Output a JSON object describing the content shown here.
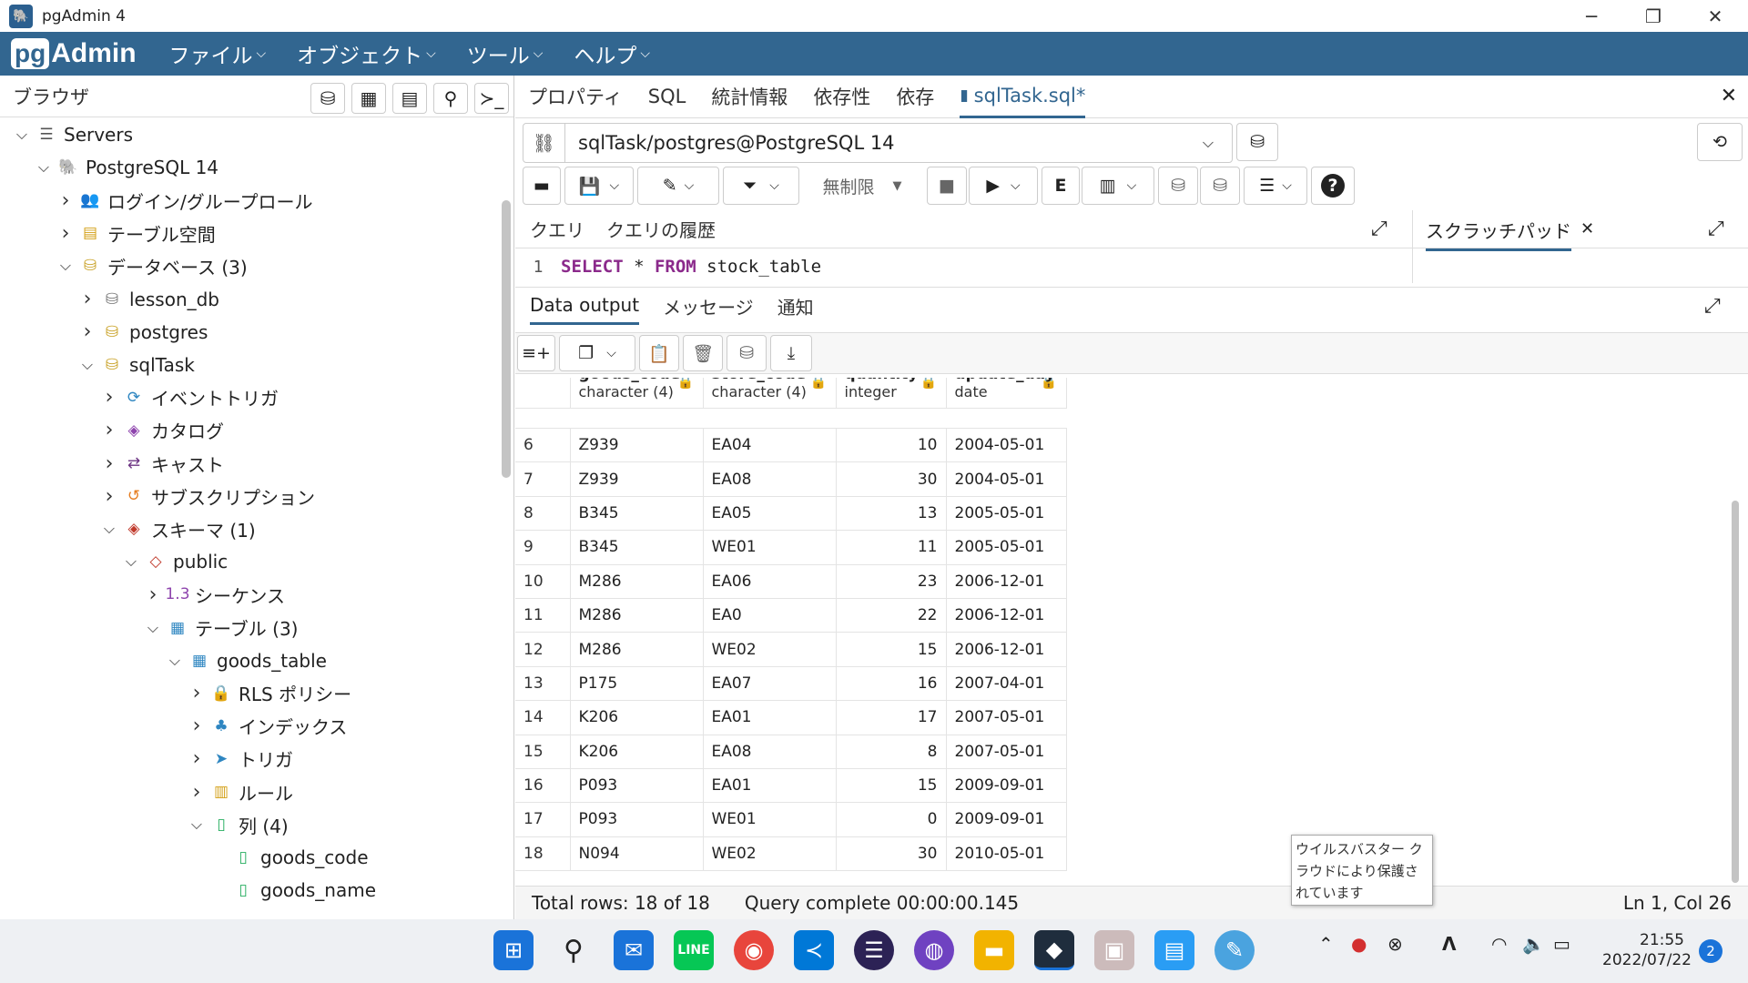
{
  "app": {
    "title": "pgAdmin 4",
    "logo_pg": "pg",
    "logo_admin": "Admin"
  },
  "menu": [
    {
      "label": "ファイル"
    },
    {
      "label": "オブジェクト"
    },
    {
      "label": "ツール"
    },
    {
      "label": "ヘルプ"
    }
  ],
  "browser": {
    "title": "ブラウザ"
  },
  "tree": [
    {
      "label": "Servers",
      "depth": 0,
      "open": true,
      "icon": "servers-icon",
      "glyph": "☰",
      "color": "#555"
    },
    {
      "label": "PostgreSQL 14",
      "depth": 1,
      "open": true,
      "icon": "elephant-icon",
      "glyph": "🐘",
      "color": "#326690"
    },
    {
      "label": "ログイン/グループロール",
      "depth": 2,
      "open": false,
      "icon": "roles-icon",
      "glyph": "👥",
      "color": "#c0392b"
    },
    {
      "label": "テーブル空間",
      "depth": 2,
      "open": false,
      "icon": "tablespace-icon",
      "glyph": "▤",
      "color": "#d4a017"
    },
    {
      "label": "データベース (3)",
      "depth": 2,
      "open": true,
      "icon": "databases-icon",
      "glyph": "⛁",
      "color": "#c9a227"
    },
    {
      "label": "lesson_db",
      "depth": 3,
      "open": false,
      "icon": "database-disconnected-icon",
      "glyph": "⛁",
      "color": "#777"
    },
    {
      "label": "postgres",
      "depth": 3,
      "open": false,
      "icon": "database-icon",
      "glyph": "⛁",
      "color": "#c9a227"
    },
    {
      "label": "sqlTask",
      "depth": 3,
      "open": true,
      "icon": "database-icon",
      "glyph": "⛁",
      "color": "#c9a227"
    },
    {
      "label": "イベントトリガ",
      "depth": 4,
      "open": false,
      "icon": "event-trigger-icon",
      "glyph": "⟳",
      "color": "#2e86c1"
    },
    {
      "label": "カタログ",
      "depth": 4,
      "open": false,
      "icon": "catalog-icon",
      "glyph": "◈",
      "color": "#8e44ad"
    },
    {
      "label": "キャスト",
      "depth": 4,
      "open": false,
      "icon": "cast-icon",
      "glyph": "⇄",
      "color": "#6c3483"
    },
    {
      "label": "サブスクリプション",
      "depth": 4,
      "open": false,
      "icon": "subscription-icon",
      "glyph": "↺",
      "color": "#e67e22"
    },
    {
      "label": "スキーマ (1)",
      "depth": 4,
      "open": true,
      "icon": "schemas-icon",
      "glyph": "◈",
      "color": "#c0392b"
    },
    {
      "label": "public",
      "depth": 5,
      "open": true,
      "icon": "schema-icon",
      "glyph": "◇",
      "color": "#c0392b"
    },
    {
      "label": "シーケンス",
      "depth": 6,
      "open": false,
      "icon": "sequence-icon",
      "glyph": "1.3",
      "color": "#8e44ad"
    },
    {
      "label": "テーブル (3)",
      "depth": 6,
      "open": true,
      "icon": "tables-icon",
      "glyph": "▦",
      "color": "#2e86c1"
    },
    {
      "label": "goods_table",
      "depth": 7,
      "open": true,
      "icon": "table-icon",
      "glyph": "▦",
      "color": "#2e86c1"
    },
    {
      "label": "RLS ポリシー",
      "depth": 8,
      "open": false,
      "icon": "rls-policy-icon",
      "glyph": "🔒",
      "color": "#27ae60"
    },
    {
      "label": "インデックス",
      "depth": 8,
      "open": false,
      "icon": "index-icon",
      "glyph": "♣",
      "color": "#2e86c1"
    },
    {
      "label": "トリガ",
      "depth": 8,
      "open": false,
      "icon": "trigger-icon",
      "glyph": "➤",
      "color": "#2e86c1"
    },
    {
      "label": "ルール",
      "depth": 8,
      "open": false,
      "icon": "rule-icon",
      "glyph": "▥",
      "color": "#d4a017"
    },
    {
      "label": "列 (4)",
      "depth": 8,
      "open": true,
      "icon": "columns-icon",
      "glyph": "▯",
      "color": "#27ae60"
    },
    {
      "label": "goods_code",
      "depth": 9,
      "open": null,
      "icon": "column-icon",
      "glyph": "▯",
      "color": "#27ae60"
    },
    {
      "label": "goods_name",
      "depth": 9,
      "open": null,
      "icon": "column-icon",
      "glyph": "▯",
      "color": "#27ae60"
    }
  ],
  "tabs": [
    {
      "label": "プロパティ"
    },
    {
      "label": "SQL"
    },
    {
      "label": "統計情報"
    },
    {
      "label": "依存性"
    },
    {
      "label": "依存"
    },
    {
      "label": "sqlTask.sql*",
      "active": true
    }
  ],
  "connection": {
    "label": "sqlTask/postgres@PostgreSQL 14"
  },
  "toolbar": {
    "limit_label": "無制限"
  },
  "query_tabs": [
    "クエリ",
    "クエリの履歴"
  ],
  "scratch": {
    "label": "スクラッチパッド"
  },
  "editor": {
    "line": "1",
    "kw1": "SELECT",
    "star": " * ",
    "kw2": "FROM",
    "rest": " stock_table"
  },
  "output_tabs": [
    "Data output",
    "メッセージ",
    "通知"
  ],
  "columns": [
    {
      "name": "goods_code",
      "type": "character (4)"
    },
    {
      "name": "store_code",
      "type": "character (4)"
    },
    {
      "name": "quantity",
      "type": "integer"
    },
    {
      "name": "update_day",
      "type": "date"
    }
  ],
  "rows": [
    [
      "6",
      "Z939",
      "EA04",
      "10",
      "2004-05-01"
    ],
    [
      "7",
      "Z939",
      "EA08",
      "30",
      "2004-05-01"
    ],
    [
      "8",
      "B345",
      "EA05",
      "13",
      "2005-05-01"
    ],
    [
      "9",
      "B345",
      "WE01",
      "11",
      "2005-05-01"
    ],
    [
      "10",
      "M286",
      "EA06",
      "23",
      "2006-12-01"
    ],
    [
      "11",
      "M286",
      "EA0",
      "22",
      "2006-12-01"
    ],
    [
      "12",
      "M286",
      "WE02",
      "15",
      "2006-12-01"
    ],
    [
      "13",
      "P175",
      "EA07",
      "16",
      "2007-04-01"
    ],
    [
      "14",
      "K206",
      "EA01",
      "17",
      "2007-05-01"
    ],
    [
      "15",
      "K206",
      "EA08",
      "8",
      "2007-05-01"
    ],
    [
      "16",
      "P093",
      "EA01",
      "15",
      "2009-09-01"
    ],
    [
      "17",
      "P093",
      "WE01",
      "0",
      "2009-09-01"
    ],
    [
      "18",
      "N094",
      "WE02",
      "30",
      "2010-05-01"
    ]
  ],
  "status": {
    "total_rows": "Total rows: 18 of 18",
    "query_complete": "Query complete 00:00:00.145",
    "cursor": "Ln 1, Col 26"
  },
  "tooltip": {
    "text": "ウイルスバスター クラウドにより保護されています"
  },
  "taskbar": {
    "time": "21:55",
    "date": "2022/07/22",
    "notif": "2"
  },
  "colors": {
    "brand": "#326690",
    "accent": "#326690"
  }
}
